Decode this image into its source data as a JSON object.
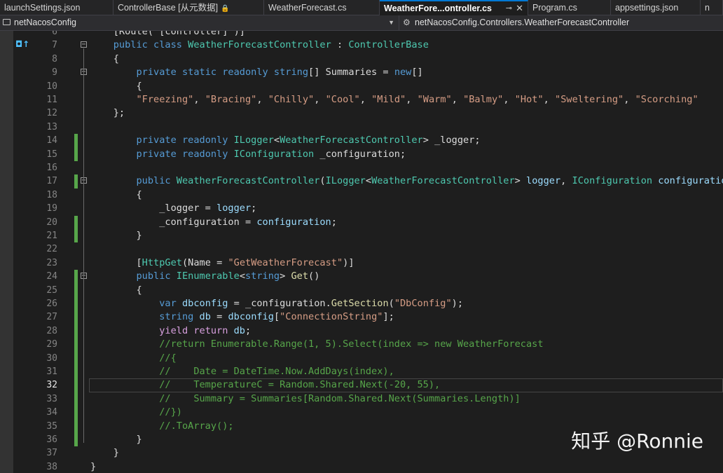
{
  "tabs": [
    {
      "label": "launchSettings.json",
      "width": 162
    },
    {
      "label": "ControllerBase [从元数据]",
      "width": 215,
      "lock": "🔒"
    },
    {
      "label": "WeatherForecast.cs",
      "width": 165
    },
    {
      "label": "WeatherFore...ontroller.cs",
      "width": 212,
      "active": true,
      "pin": "⊸",
      "close": "✕"
    },
    {
      "label": "Program.cs",
      "width": 118
    },
    {
      "label": "appsettings.json",
      "width": 128
    },
    {
      "label": "n",
      "width": 32
    }
  ],
  "navbar": {
    "project": "netNacosConfig",
    "member": "netNacosConfig.Controllers.WeatherForecastController",
    "dropdown": "▼"
  },
  "gutter_glyph": "◘↑",
  "editor": {
    "current_line": 32,
    "lines": [
      {
        "n": "6",
        "segs": [
          [
            "    [Route(\"[controller]\")]",
            "pl"
          ]
        ]
      },
      {
        "n": "7",
        "segs": [
          [
            "    ",
            "pl"
          ],
          [
            "public class ",
            "kw"
          ],
          [
            "WeatherForecastController",
            "ty"
          ],
          [
            " : ",
            "pl"
          ],
          [
            "ControllerBase",
            "ty"
          ]
        ],
        "fold": "−"
      },
      {
        "n": "8",
        "segs": [
          [
            "    {",
            "pl"
          ]
        ]
      },
      {
        "n": "9",
        "segs": [
          [
            "        ",
            "pl"
          ],
          [
            "private static readonly string",
            "kw"
          ],
          [
            "[] ",
            "pl"
          ],
          [
            "Summaries",
            "pl"
          ],
          [
            " = ",
            "pl"
          ],
          [
            "new",
            "kw"
          ],
          [
            "[]",
            "pl"
          ]
        ],
        "fold": "−"
      },
      {
        "n": "10",
        "segs": [
          [
            "        {",
            "pl"
          ]
        ]
      },
      {
        "n": "11",
        "segs": [
          [
            "        ",
            "pl"
          ],
          [
            "\"Freezing\"",
            "str"
          ],
          [
            ", ",
            "pl"
          ],
          [
            "\"Bracing\"",
            "str"
          ],
          [
            ", ",
            "pl"
          ],
          [
            "\"Chilly\"",
            "str"
          ],
          [
            ", ",
            "pl"
          ],
          [
            "\"Cool\"",
            "str"
          ],
          [
            ", ",
            "pl"
          ],
          [
            "\"Mild\"",
            "str"
          ],
          [
            ", ",
            "pl"
          ],
          [
            "\"Warm\"",
            "str"
          ],
          [
            ", ",
            "pl"
          ],
          [
            "\"Balmy\"",
            "str"
          ],
          [
            ", ",
            "pl"
          ],
          [
            "\"Hot\"",
            "str"
          ],
          [
            ", ",
            "pl"
          ],
          [
            "\"Sweltering\"",
            "str"
          ],
          [
            ", ",
            "pl"
          ],
          [
            "\"Scorching\"",
            "str"
          ]
        ]
      },
      {
        "n": "12",
        "segs": [
          [
            "    };",
            "pl"
          ]
        ]
      },
      {
        "n": "13",
        "segs": [
          [
            "",
            "pl"
          ]
        ]
      },
      {
        "n": "14",
        "segs": [
          [
            "        ",
            "pl"
          ],
          [
            "private readonly ",
            "kw"
          ],
          [
            "ILogger",
            "ty"
          ],
          [
            "<",
            "pl"
          ],
          [
            "WeatherForecastController",
            "ty"
          ],
          [
            "> ",
            "pl"
          ],
          [
            "_logger",
            "pl"
          ],
          [
            ";",
            "pl"
          ]
        ],
        "chg": true
      },
      {
        "n": "15",
        "segs": [
          [
            "        ",
            "pl"
          ],
          [
            "private readonly ",
            "kw"
          ],
          [
            "IConfiguration",
            "ty"
          ],
          [
            " _configuration;",
            "pl"
          ]
        ],
        "chg": true
      },
      {
        "n": "16",
        "segs": [
          [
            "",
            "pl"
          ]
        ]
      },
      {
        "n": "17",
        "segs": [
          [
            "        ",
            "pl"
          ],
          [
            "public ",
            "kw"
          ],
          [
            "WeatherForecastController",
            "ty"
          ],
          [
            "(",
            "pl"
          ],
          [
            "ILogger",
            "ty"
          ],
          [
            "<",
            "pl"
          ],
          [
            "WeatherForecastController",
            "ty"
          ],
          [
            "> ",
            "pl"
          ],
          [
            "logger",
            "id"
          ],
          [
            ", ",
            "pl"
          ],
          [
            "IConfiguration",
            "ty"
          ],
          [
            " ",
            "pl"
          ],
          [
            "configuration",
            "id"
          ],
          [
            ")",
            "pl"
          ]
        ],
        "chg": true,
        "fold": "−"
      },
      {
        "n": "18",
        "segs": [
          [
            "        {",
            "pl"
          ]
        ]
      },
      {
        "n": "19",
        "segs": [
          [
            "            _logger = ",
            "pl"
          ],
          [
            "logger",
            "id"
          ],
          [
            ";",
            "pl"
          ]
        ]
      },
      {
        "n": "20",
        "segs": [
          [
            "            _configuration = ",
            "pl"
          ],
          [
            "configuration",
            "id"
          ],
          [
            ";",
            "pl"
          ]
        ],
        "chg": true
      },
      {
        "n": "21",
        "segs": [
          [
            "        }",
            "pl"
          ]
        ],
        "chg": true
      },
      {
        "n": "22",
        "segs": [
          [
            "",
            "pl"
          ]
        ]
      },
      {
        "n": "23",
        "segs": [
          [
            "        [",
            "pl"
          ],
          [
            "HttpGet",
            "ty"
          ],
          [
            "(Name = ",
            "pl"
          ],
          [
            "\"GetWeatherForecast\"",
            "str"
          ],
          [
            ")]",
            "pl"
          ]
        ]
      },
      {
        "n": "24",
        "segs": [
          [
            "        ",
            "pl"
          ],
          [
            "public ",
            "kw"
          ],
          [
            "IEnumerable",
            "ty"
          ],
          [
            "<",
            "pl"
          ],
          [
            "string",
            "kw"
          ],
          [
            "> ",
            "pl"
          ],
          [
            "Get",
            "fn"
          ],
          [
            "()",
            "pl"
          ]
        ],
        "chg": true,
        "fold": "−"
      },
      {
        "n": "25",
        "segs": [
          [
            "        {",
            "pl"
          ]
        ],
        "chg": true
      },
      {
        "n": "26",
        "segs": [
          [
            "            ",
            "pl"
          ],
          [
            "var ",
            "kw"
          ],
          [
            "dbconfig",
            "id"
          ],
          [
            " = _configuration.",
            "pl"
          ],
          [
            "GetSection",
            "fn"
          ],
          [
            "(",
            "pl"
          ],
          [
            "\"DbConfig\"",
            "str"
          ],
          [
            ");",
            "pl"
          ]
        ],
        "chg": true
      },
      {
        "n": "27",
        "segs": [
          [
            "            ",
            "pl"
          ],
          [
            "string ",
            "kw"
          ],
          [
            "db",
            "id"
          ],
          [
            " = ",
            "pl"
          ],
          [
            "dbconfig",
            "id"
          ],
          [
            "[",
            "pl"
          ],
          [
            "\"ConnectionString\"",
            "str"
          ],
          [
            "];",
            "pl"
          ]
        ],
        "chg": true
      },
      {
        "n": "28",
        "segs": [
          [
            "            ",
            "pl"
          ],
          [
            "yield return ",
            "ctl"
          ],
          [
            "db",
            "id"
          ],
          [
            ";",
            "pl"
          ]
        ],
        "chg": true
      },
      {
        "n": "29",
        "segs": [
          [
            "            //return Enumerable.Range(1, 5).Select(index => new WeatherForecast",
            "cm"
          ]
        ],
        "chg": true
      },
      {
        "n": "30",
        "segs": [
          [
            "            //{",
            "cm"
          ]
        ],
        "chg": true
      },
      {
        "n": "31",
        "segs": [
          [
            "            //    Date = DateTime.Now.AddDays(index),",
            "cm"
          ]
        ],
        "chg": true
      },
      {
        "n": "32",
        "segs": [
          [
            "            //    TemperatureC = Random.Shared.Next(-20, 55),",
            "cm"
          ]
        ],
        "chg": true
      },
      {
        "n": "33",
        "segs": [
          [
            "            //    Summary = Summaries[Random.Shared.Next(Summaries.Length)]",
            "cm"
          ]
        ],
        "chg": true
      },
      {
        "n": "34",
        "segs": [
          [
            "            //})",
            "cm"
          ]
        ],
        "chg": true
      },
      {
        "n": "35",
        "segs": [
          [
            "            //.ToArray();",
            "cm"
          ]
        ],
        "chg": true
      },
      {
        "n": "36",
        "segs": [
          [
            "        }",
            "pl"
          ]
        ],
        "chg": true
      },
      {
        "n": "37",
        "segs": [
          [
            "    }",
            "pl"
          ]
        ]
      },
      {
        "n": "38",
        "segs": [
          [
            "}",
            "pl"
          ]
        ]
      }
    ]
  },
  "watermark": "知乎 @Ronnie"
}
